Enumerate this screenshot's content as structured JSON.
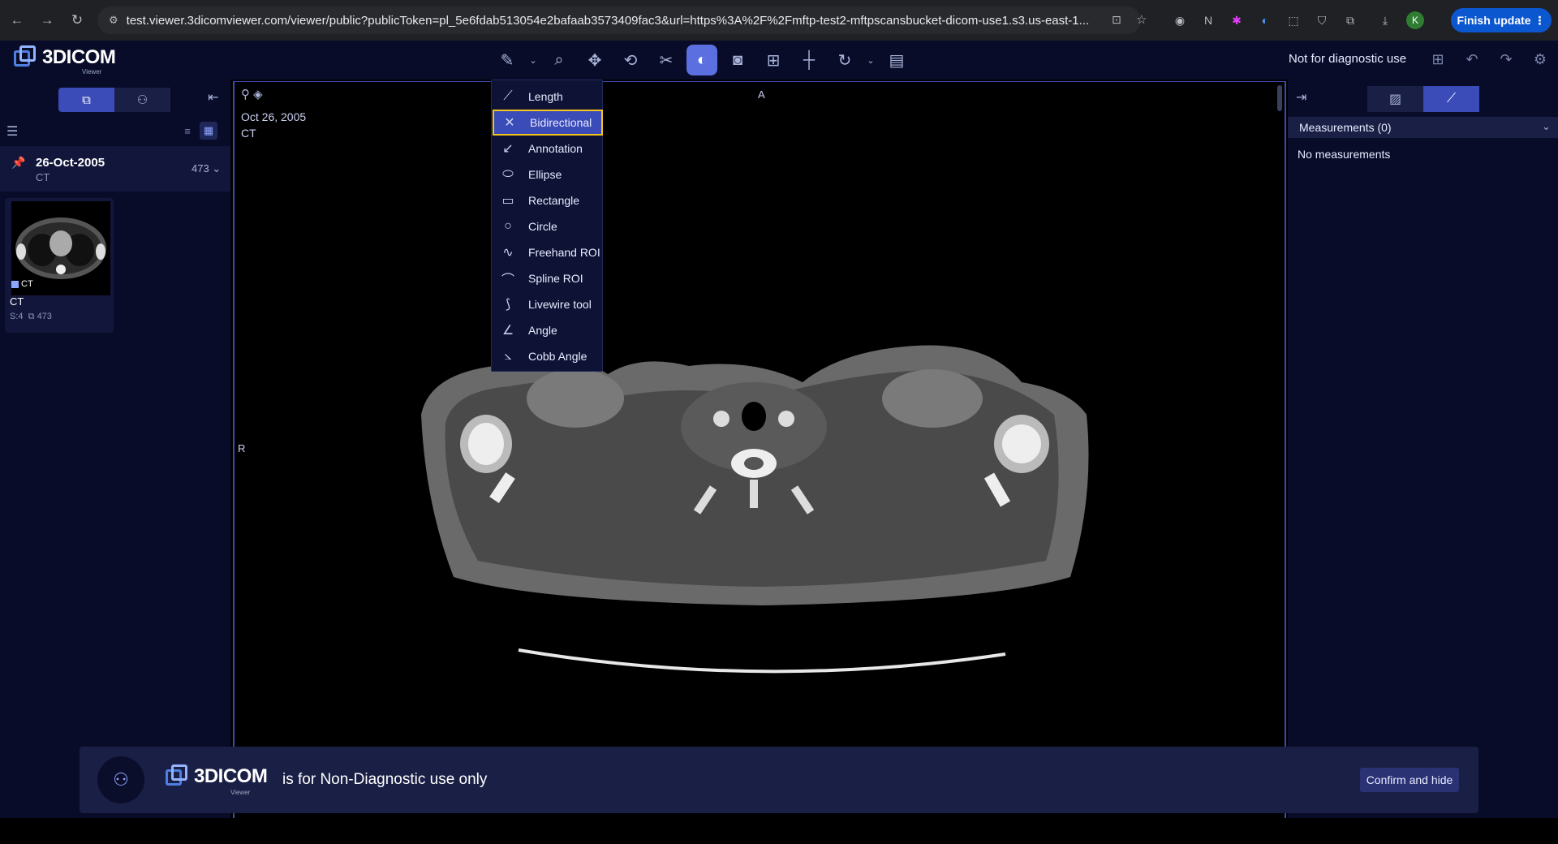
{
  "browser": {
    "url": "test.viewer.3dicomviewer.com/viewer/public?publicToken=pl_5e6fdab513054e2bafaab3573409fac3&url=https%3A%2F%2Fmftp-test2-mftpscansbucket-dicom-use1.s3.us-east-1...",
    "profile_initial": "K",
    "finish_update_label": "Finish update"
  },
  "header": {
    "logo_text": "3DICOM",
    "logo_sub": "Viewer",
    "diagnostic_notice": "Not for diagnostic use"
  },
  "left_panel": {
    "study": {
      "date": "26-Oct-2005",
      "modality": "CT",
      "count": "473"
    },
    "series_thumb": {
      "badge": "CT",
      "title": "CT",
      "series": "S:4",
      "images": "473"
    }
  },
  "viewport": {
    "date": "Oct 26, 2005",
    "modality": "CT",
    "orient_top": "A",
    "orient_left": "R"
  },
  "measure_menu": {
    "items": [
      {
        "label": "Length",
        "icon": "ruler-icon"
      },
      {
        "label": "Bidirectional",
        "icon": "bidirectional-icon"
      },
      {
        "label": "Annotation",
        "icon": "arrow-annotate-icon"
      },
      {
        "label": "Ellipse",
        "icon": "ellipse-icon"
      },
      {
        "label": "Rectangle",
        "icon": "rectangle-icon"
      },
      {
        "label": "Circle",
        "icon": "circle-icon"
      },
      {
        "label": "Freehand ROI",
        "icon": "freehand-icon"
      },
      {
        "label": "Spline ROI",
        "icon": "spline-icon"
      },
      {
        "label": "Livewire tool",
        "icon": "livewire-icon"
      },
      {
        "label": "Angle",
        "icon": "angle-icon"
      },
      {
        "label": "Cobb Angle",
        "icon": "cobb-angle-icon"
      }
    ],
    "highlighted": "Bidirectional"
  },
  "right_panel": {
    "measurements_title": "Measurements (0)",
    "empty_text": "No measurements"
  },
  "banner": {
    "logo_text": "3DICOM",
    "logo_sub": "Viewer",
    "message": "is for Non-Diagnostic use only",
    "confirm_label": "Confirm and hide"
  }
}
